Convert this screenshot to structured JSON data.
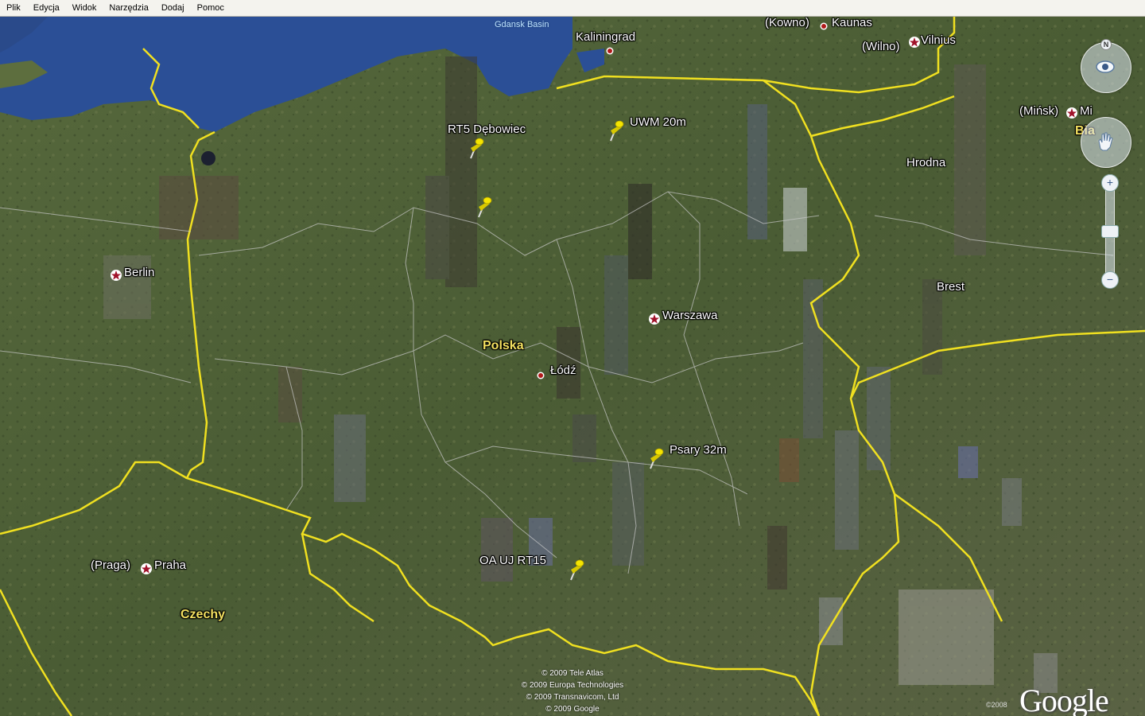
{
  "menu": [
    "Plik",
    "Edycja",
    "Widok",
    "Narzędzia",
    "Dodaj",
    "Pomoc"
  ],
  "map": {
    "water_labels": [
      "Gdansk Basin"
    ],
    "country_labels": [
      "Polska",
      "Czechy"
    ],
    "city_labels": {
      "kowno": "(Kowno)",
      "kaunas": "Kaunas",
      "kaliningrad": "Kaliningrad",
      "wilno": "(Wilno)",
      "vilnius": "Vilnius",
      "minsk_pl": "(Mińsk)",
      "minsk": "Mi",
      "bia": "Bia",
      "hrodna": "Hrodna",
      "brest": "Brest",
      "berlin": "Berlin",
      "warszawa": "Warszawa",
      "lodz": "Łódź",
      "praga": "(Praga)",
      "praha": "Praha"
    },
    "placemarks": [
      "RT5  Dębowiec",
      "UWM 20m",
      "Psary 32m",
      "OA UJ RT15",
      ""
    ],
    "attribution": [
      "© 2009 Tele Atlas",
      "© 2009 Europa Technologies",
      "© 2009 Transnavicom, Ltd",
      "© 2009 Google"
    ],
    "logo": "Google",
    "logo_year": "©2008"
  },
  "nav": {
    "north_label": "N",
    "look_icon": "eye-icon",
    "move_icon": "hand-icon",
    "zoom_in": "+",
    "zoom_out": "−",
    "zoom_level": 0.4
  },
  "colors": {
    "land": "#4b5e35",
    "sea": "#2b4f96",
    "border": "#f0e020",
    "pin": "#f4e400"
  }
}
